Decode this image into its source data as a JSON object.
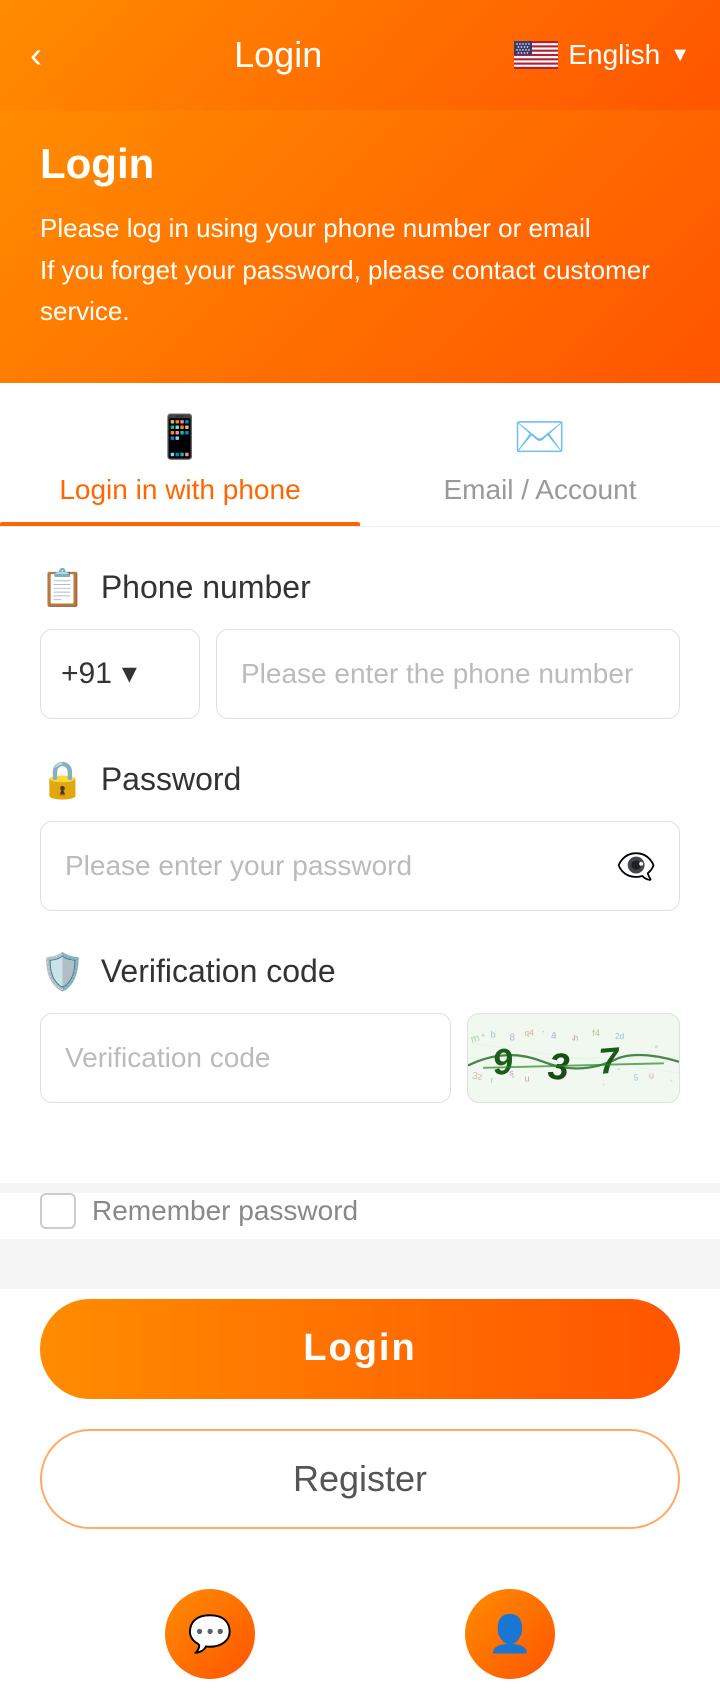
{
  "header": {
    "back_label": "‹",
    "title": "Login",
    "language": "English",
    "language_icon": "🇺🇸"
  },
  "hero": {
    "title": "Login",
    "line1": "Please log in using your phone number or email",
    "line2": "If you forget your password, please contact customer service."
  },
  "tabs": [
    {
      "id": "phone",
      "label": "Login in with phone",
      "active": true
    },
    {
      "id": "email",
      "label": "Email / Account",
      "active": false
    }
  ],
  "form": {
    "phone_label": "Phone number",
    "phone_country_code": "+91",
    "phone_placeholder": "Please enter the phone number",
    "password_label": "Password",
    "password_placeholder": "Please enter your password",
    "verification_label": "Verification code",
    "verification_placeholder": "Verification code",
    "remember_label": "Remember password"
  },
  "buttons": {
    "login": "Login",
    "register": "Register"
  }
}
